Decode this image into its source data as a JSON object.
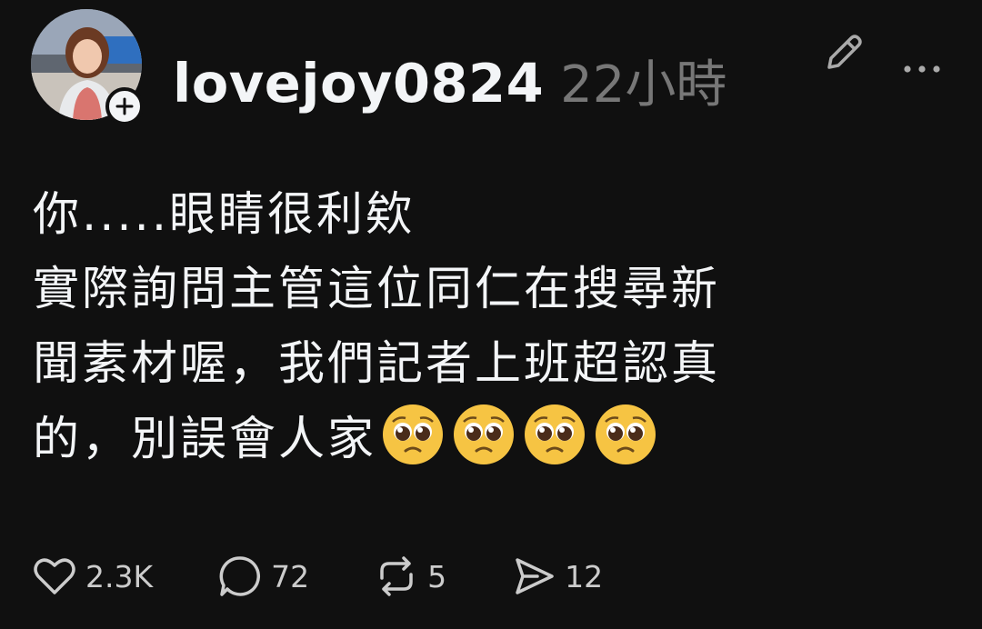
{
  "post": {
    "username": "lovejoy0824",
    "time": "22小時",
    "lines": [
      "你.....眼睛很利欸",
      "實際詢問主管這位同仁在搜尋新",
      "聞素材喔，我們記者上班超認真",
      "的，別誤會人家"
    ],
    "emoji": [
      "pleading-face",
      "pleading-face",
      "pleading-face",
      "pleading-face"
    ]
  },
  "actions": {
    "likes": "2.3K",
    "replies": "72",
    "reposts": "5",
    "shares": "12"
  },
  "icons": {
    "follow": "plus-icon",
    "edit": "pencil-icon",
    "more": "more-dots-icon",
    "like": "heart-icon",
    "reply": "comment-icon",
    "repost": "repost-icon",
    "share": "send-icon"
  },
  "colors": {
    "background": "#101010",
    "text": "#f3f5f7",
    "muted": "#777777"
  }
}
